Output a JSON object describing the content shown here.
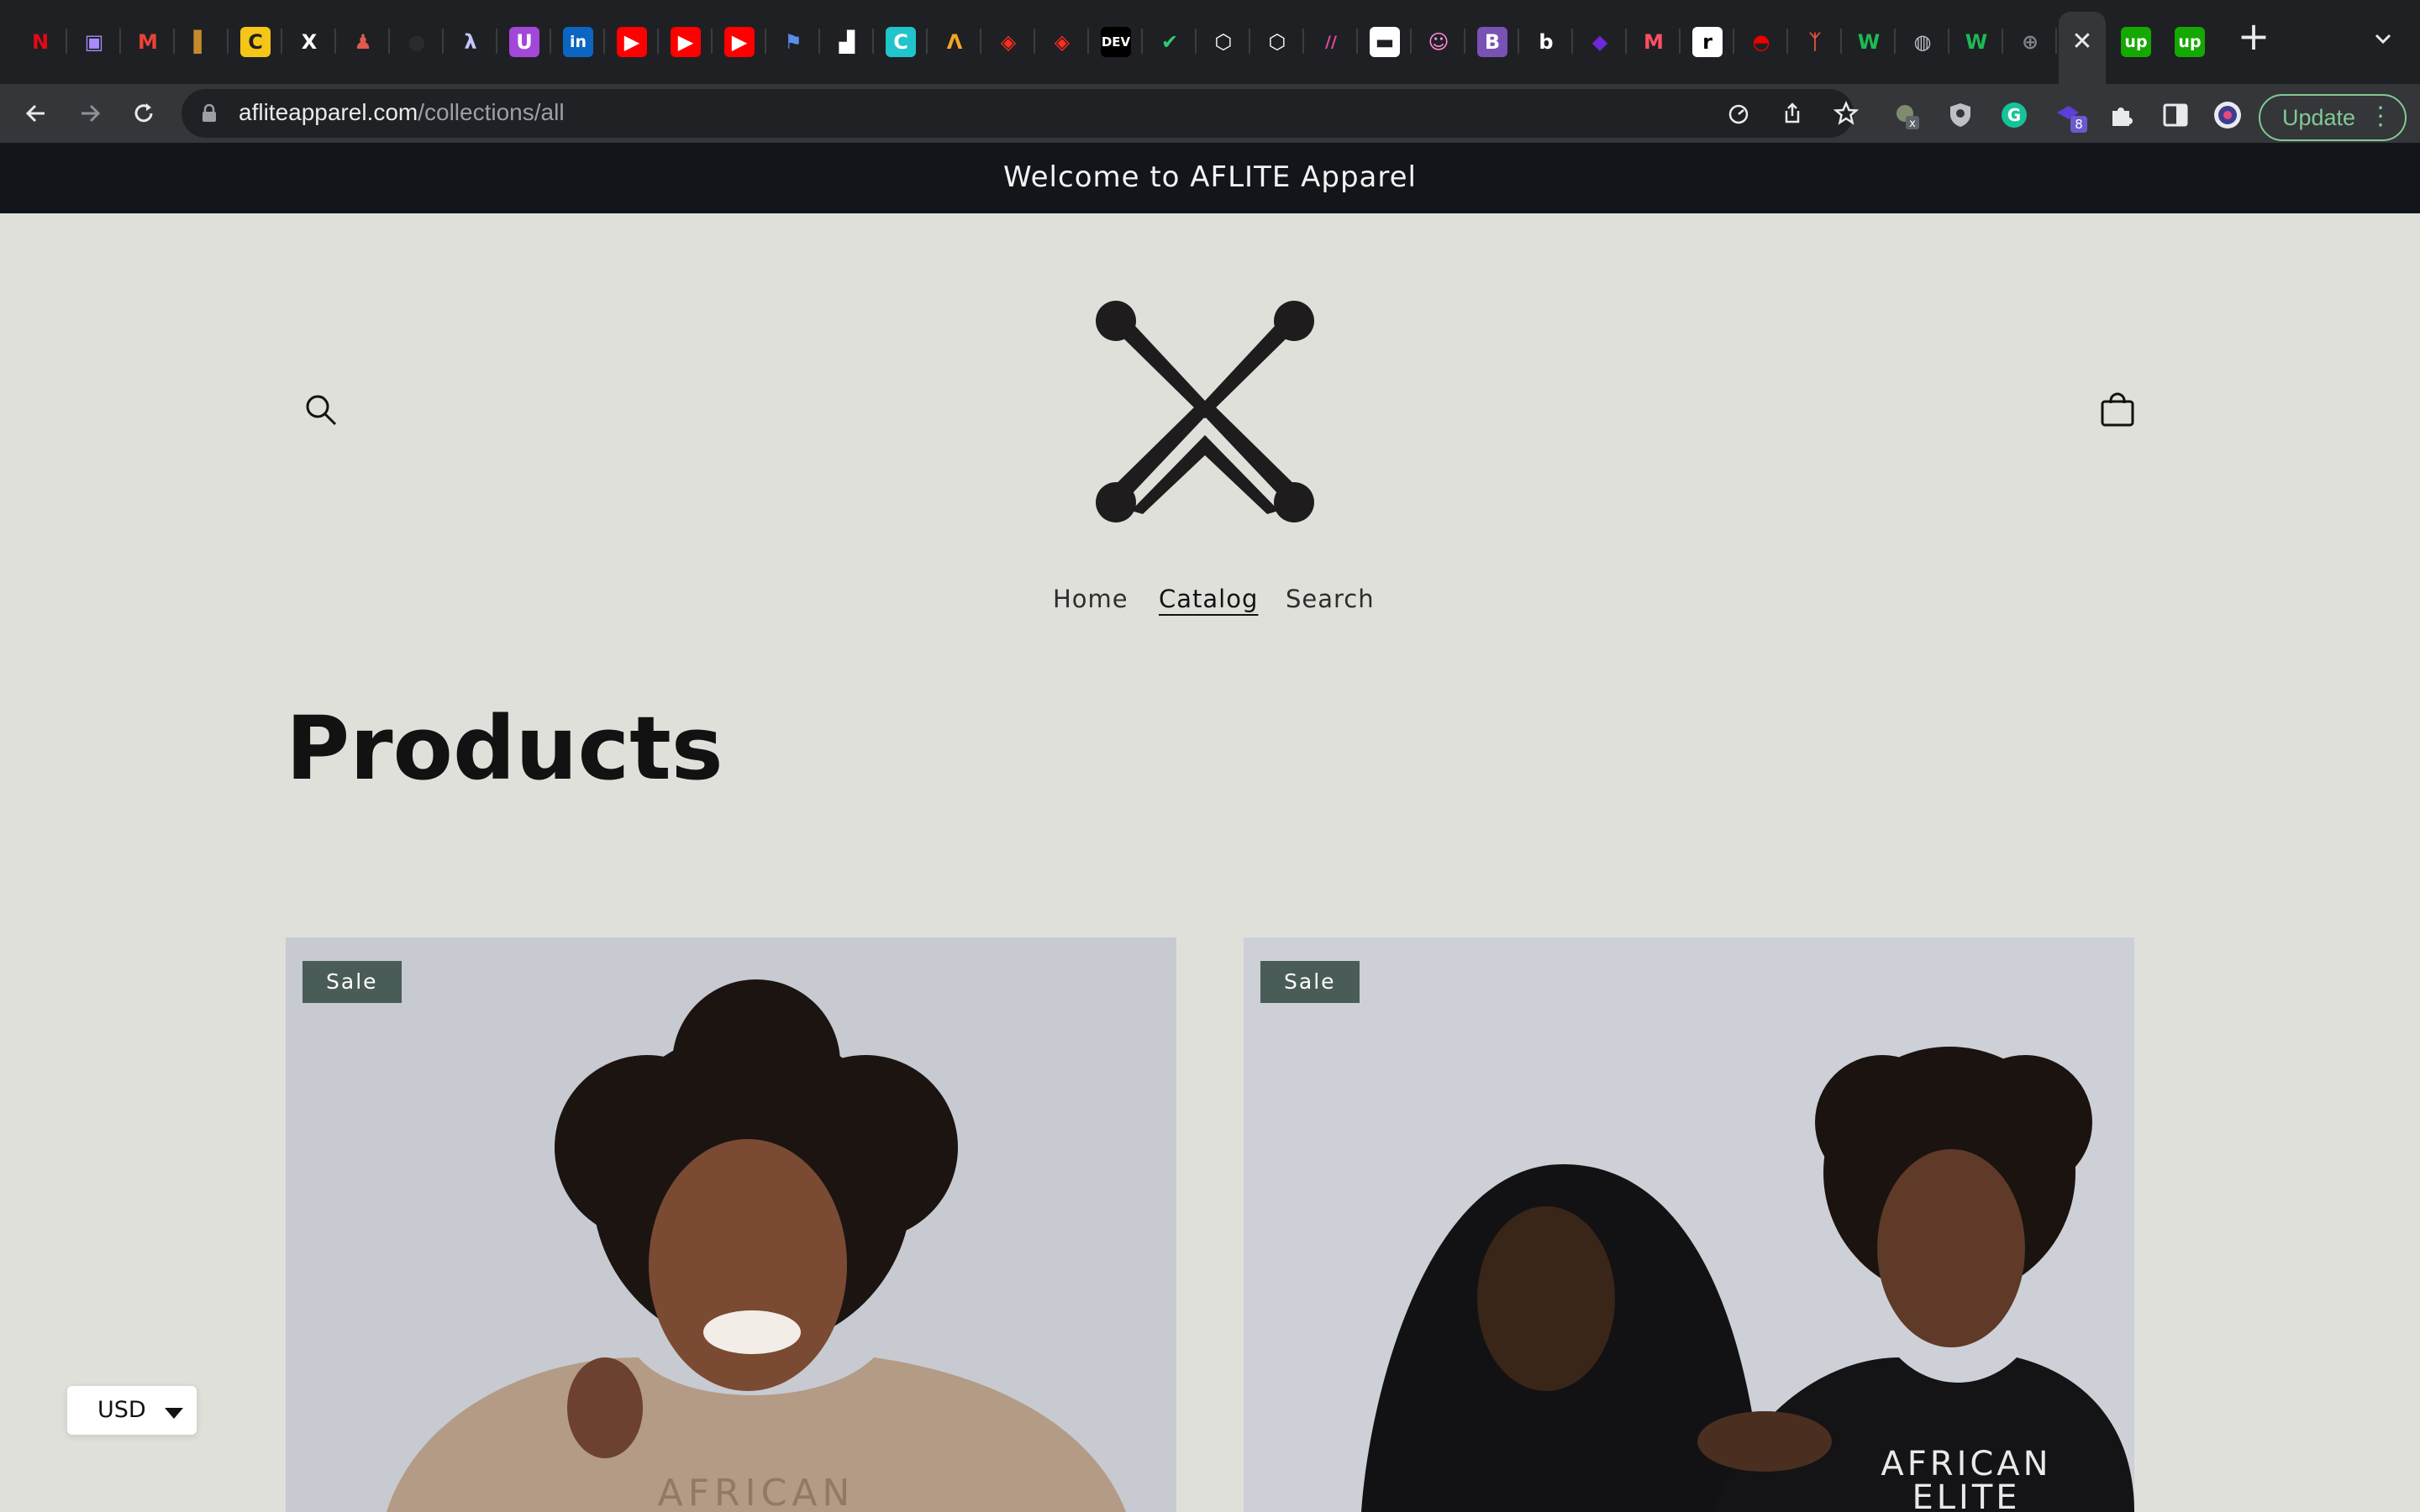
{
  "browser": {
    "tabs": [
      {
        "icon": "netflix-icon",
        "glyph": "N",
        "color": "#e50914",
        "bg": "transparent"
      },
      {
        "icon": "video-camera-icon",
        "glyph": "▣",
        "color": "#a78bfa",
        "bg": "transparent"
      },
      {
        "icon": "gmail-icon",
        "glyph": "M",
        "color": "#ea4335",
        "bg": "transparent"
      },
      {
        "icon": "book-icon",
        "glyph": "▌",
        "color": "#c58a2c",
        "bg": "transparent"
      },
      {
        "icon": "c-circle-icon",
        "glyph": "C",
        "color": "#1f2023",
        "bg": "#f5c518"
      },
      {
        "icon": "x-twitter-icon",
        "glyph": "X",
        "color": "#ffffff",
        "bg": "transparent"
      },
      {
        "icon": "figure-icon",
        "glyph": "♟",
        "color": "#e05a4f",
        "bg": "transparent"
      },
      {
        "icon": "github-icon",
        "glyph": "●",
        "color": "#2a2b2e",
        "bg": "transparent"
      },
      {
        "icon": "lambda-icon",
        "glyph": "λ",
        "color": "#c4c7ff",
        "bg": "#1f2023"
      },
      {
        "icon": "u-circle-icon",
        "glyph": "U",
        "color": "#ffffff",
        "bg": "#a347d9"
      },
      {
        "icon": "linkedin-icon",
        "glyph": "in",
        "color": "#ffffff",
        "bg": "#0a66c2"
      },
      {
        "icon": "youtube-icon",
        "glyph": "▶",
        "color": "#ffffff",
        "bg": "#ff0000"
      },
      {
        "icon": "youtube-icon",
        "glyph": "▶",
        "color": "#ffffff",
        "bg": "#ff0000"
      },
      {
        "icon": "youtube-icon",
        "glyph": "▶",
        "color": "#ffffff",
        "bg": "#ff0000"
      },
      {
        "icon": "flag-icon",
        "glyph": "⚑",
        "color": "#5b8def",
        "bg": "transparent"
      },
      {
        "icon": "unsplash-icon",
        "glyph": "▟",
        "color": "#ffffff",
        "bg": "transparent"
      },
      {
        "icon": "canva-icon",
        "glyph": "C",
        "color": "#ffffff",
        "bg": "#20c4cb"
      },
      {
        "icon": "laravel-icon",
        "glyph": "Λ",
        "color": "#f5a623",
        "bg": "transparent"
      },
      {
        "icon": "laravel-icon",
        "glyph": "◈",
        "color": "#ff2d20",
        "bg": "transparent"
      },
      {
        "icon": "laravel-icon",
        "glyph": "◈",
        "color": "#ff2d20",
        "bg": "transparent"
      },
      {
        "icon": "dev-to-icon",
        "glyph": "DEV",
        "color": "#ffffff",
        "bg": "#000000"
      },
      {
        "icon": "checkmark-icon",
        "glyph": "✔",
        "color": "#2ecc71",
        "bg": "transparent"
      },
      {
        "icon": "hexagon-icon",
        "glyph": "⬡",
        "color": "#ffffff",
        "bg": "transparent"
      },
      {
        "icon": "hexagon-icon",
        "glyph": "⬡",
        "color": "#ffffff",
        "bg": "transparent"
      },
      {
        "icon": "slash-icon",
        "glyph": "//",
        "color": "#e04ba0",
        "bg": "transparent"
      },
      {
        "icon": "flowbite-icon",
        "glyph": "▬",
        "color": "#1f2023",
        "bg": "#ffffff"
      },
      {
        "icon": "ghost-icon",
        "glyph": "☺",
        "color": "#ff8ad8",
        "bg": "transparent"
      },
      {
        "icon": "bootstrap-icon",
        "glyph": "B",
        "color": "#ffffff",
        "bg": "#7952b3"
      },
      {
        "icon": "bitbucket-icon",
        "glyph": "b",
        "color": "#ffffff",
        "bg": "transparent"
      },
      {
        "icon": "diamond-icon",
        "glyph": "◆",
        "color": "#6d28d9",
        "bg": "transparent"
      },
      {
        "icon": "m-logo-icon",
        "glyph": "M",
        "color": "#ff4f64",
        "bg": "transparent"
      },
      {
        "icon": "r-logo-icon",
        "glyph": "r",
        "color": "#000000",
        "bg": "#ffffff"
      },
      {
        "icon": "redhat-icon",
        "glyph": "◓",
        "color": "#ee0000",
        "bg": "transparent"
      },
      {
        "icon": "dancer-icon",
        "glyph": "ᛉ",
        "color": "#e74c3c",
        "bg": "transparent"
      },
      {
        "icon": "w-logo-icon",
        "glyph": "W",
        "color": "#1db954",
        "bg": "transparent"
      },
      {
        "icon": "globe-icon",
        "glyph": "◍",
        "color": "#bdc1c6",
        "bg": "transparent"
      },
      {
        "icon": "w-logo-icon",
        "glyph": "W",
        "color": "#1db954",
        "bg": "transparent"
      },
      {
        "icon": "globe-grid-icon",
        "glyph": "⊕",
        "color": "#7f8389",
        "bg": "transparent"
      }
    ],
    "trailing_tabs": [
      {
        "icon": "upwork-icon",
        "glyph": "up",
        "color": "#ffffff",
        "bg": "#14a800"
      },
      {
        "icon": "upwork-icon",
        "glyph": "up",
        "color": "#ffffff",
        "bg": "#14a800"
      }
    ],
    "url_domain": "afliteapparel.com",
    "url_path": "/collections/all",
    "extension_badge": "8",
    "update_label": "Update"
  },
  "announcement": "Welcome to AFLITE Apparel",
  "nav": {
    "items": [
      {
        "label": "Home",
        "active": false
      },
      {
        "label": "Catalog",
        "active": true
      },
      {
        "label": "Search",
        "active": false
      }
    ]
  },
  "page_title": "Products",
  "products": [
    {
      "badge": "Sale",
      "image_text": "AFRICAN"
    },
    {
      "badge": "Sale",
      "image_text_1": "AFRICAN",
      "image_text_2": "ELITE"
    }
  ],
  "currency": {
    "code": "USD"
  },
  "colors": {
    "announcement_bg": "#121519",
    "page_bg": "#dfe0da",
    "sale_badge": "#4a5c57"
  }
}
